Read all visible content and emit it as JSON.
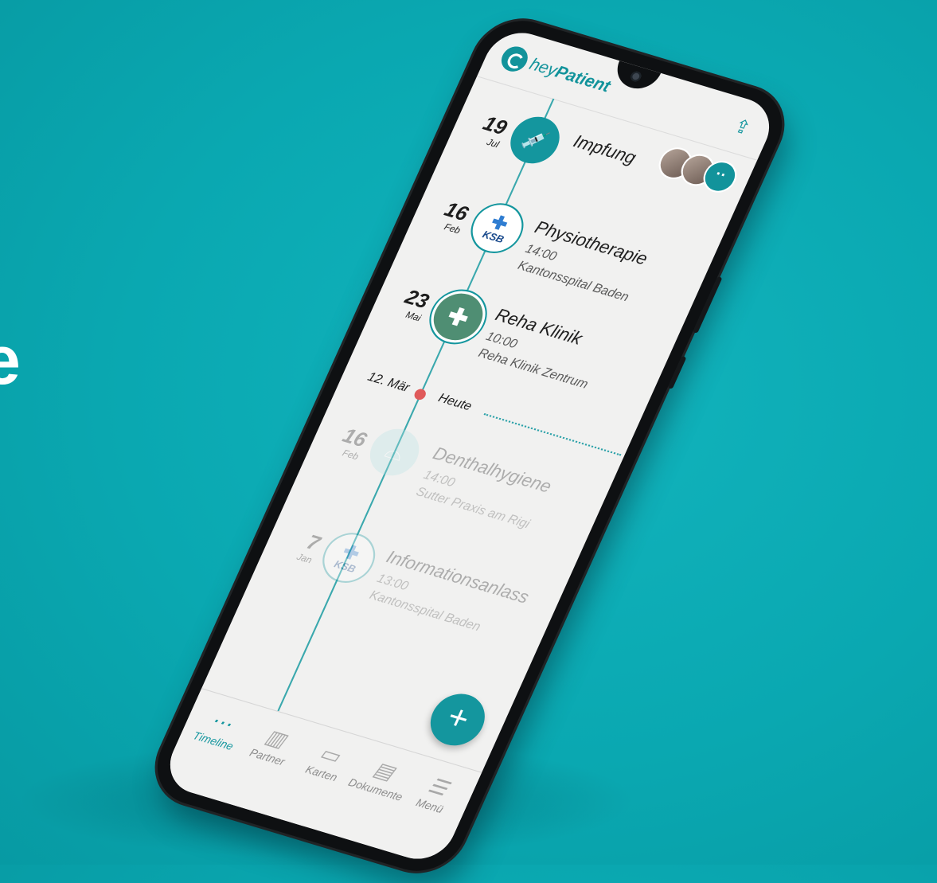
{
  "background_fragment": "e",
  "app": {
    "logo_prefix": "hey",
    "logo_name": "Patient",
    "accent_color": "#14969e"
  },
  "icons": {
    "logo": "heypatient-logo-icon",
    "share": "share-upload-icon",
    "avatars_more": "more-dots-icon",
    "syringe": "syringe-icon",
    "ksb": "ksb-hospital-logo-icon",
    "clinic": "medical-cross-icon",
    "tooth": "tooth-icon",
    "add": "plus-icon"
  },
  "avatars": {
    "more": "··"
  },
  "events": [
    {
      "day": "19",
      "month": "Jul",
      "title": "Impfung",
      "time": "",
      "place": "",
      "icon_glyph": "💉"
    },
    {
      "day": "16",
      "month": "Feb",
      "title": "Physiotherapie",
      "time": "14:00",
      "place": "Kantonsspital Baden",
      "icon_label": "KSB"
    },
    {
      "day": "23",
      "month": "Mai",
      "title": "Reha Klinik",
      "time": "10:00",
      "place": "Reha Klinik Zentrum",
      "icon_glyph": "✚"
    },
    {
      "day": "16",
      "month": "Feb",
      "title": "Denthalhygiene",
      "time": "14:00",
      "place": "Sutter Praxis am Rigi",
      "icon_glyph": "⌓"
    },
    {
      "day": "7",
      "month": "Jan",
      "title": "Informationsanlass",
      "time": "13:00",
      "place": "Kantonsspital Baden",
      "icon_label": "KSB"
    }
  ],
  "today": {
    "date": "12. Mär",
    "label": "Heute",
    "marker_color": "#e05a5a"
  },
  "fab": {
    "label": "+"
  },
  "nav": [
    {
      "label": "Timeline",
      "icon": "timeline-icon",
      "glyph": "⋯",
      "active": true
    },
    {
      "label": "Partner",
      "icon": "hospital-building-icon",
      "glyph": "▥",
      "active": false
    },
    {
      "label": "Karten",
      "icon": "card-icon",
      "glyph": "▭",
      "active": false
    },
    {
      "label": "Dokumente",
      "icon": "document-icon",
      "glyph": "▤",
      "active": false
    },
    {
      "label": "Menü",
      "icon": "hamburger-menu-icon",
      "glyph": "☰",
      "active": false
    }
  ]
}
